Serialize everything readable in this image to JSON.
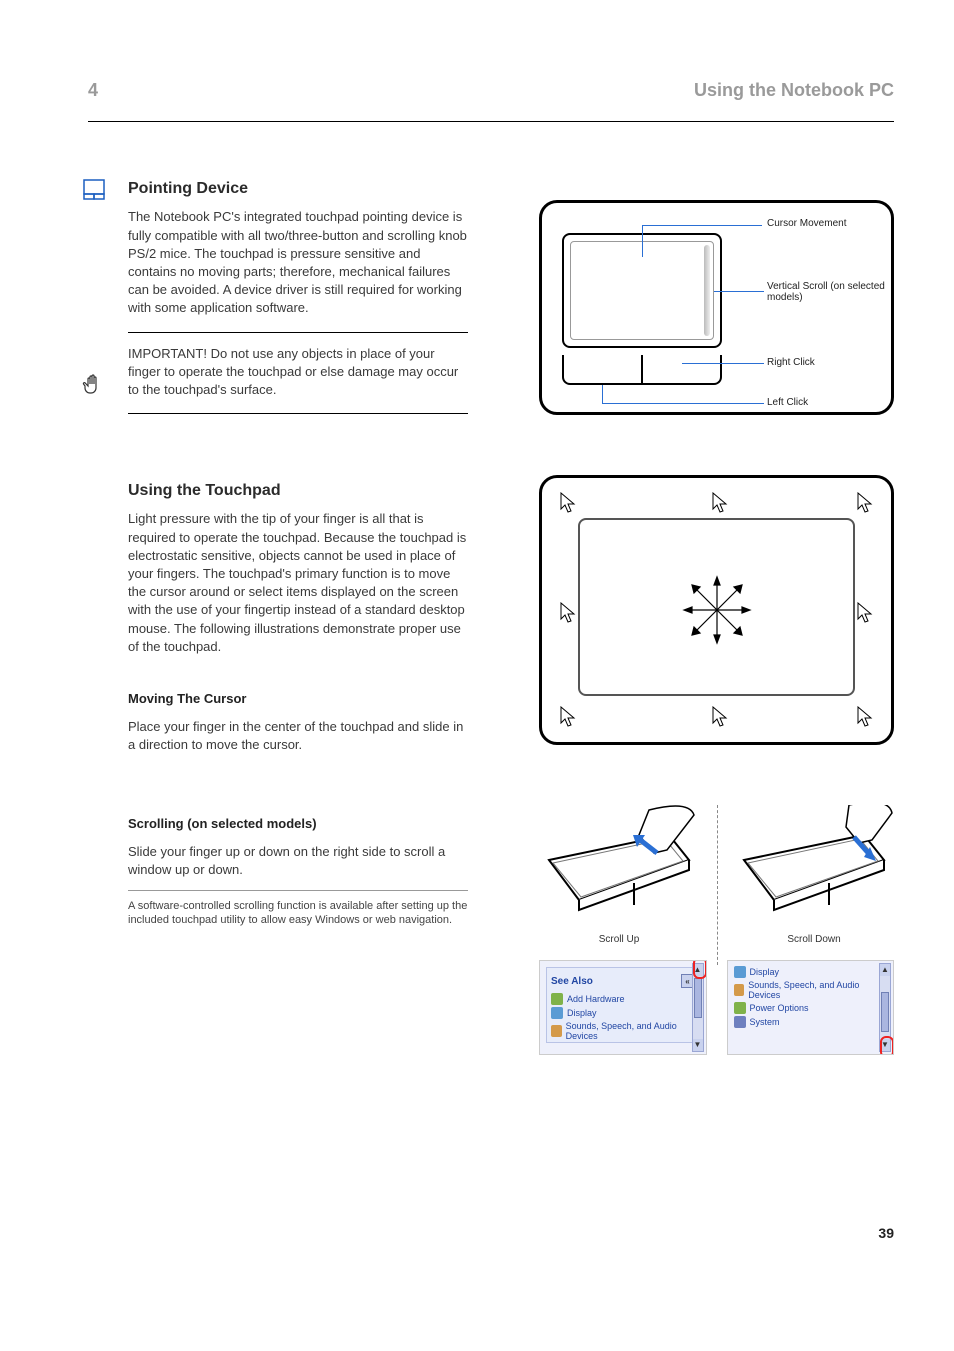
{
  "header": {
    "section_number": "4",
    "section_title": "Using the Notebook PC"
  },
  "sections": {
    "pointing_title": "Pointing Device",
    "pointing_text": "The Notebook PC's integrated touchpad pointing device is fully compatible with all two/three-button and scrolling knob PS/2 mice. The touchpad is pressure sensitive and contains no moving parts; therefore, mechanical failures can be avoided. A device driver is still required for working with some application software.",
    "important_text": "IMPORTANT! Do not use any objects in place of your finger to operate the touchpad or else damage may occur to the touchpad's surface.",
    "using_title": "Using the Touchpad",
    "using_text": "Light pressure with the tip of your finger is all that is required to operate the touchpad. Because the touchpad is electrostatic sensitive, objects cannot be used in place of your fingers. The touchpad's primary function is to move the cursor around or select items displayed on the screen with the use of your fingertip instead of a standard desktop mouse. The following illustrations demonstrate proper use of the touchpad.",
    "moving_title": "Moving The Cursor",
    "moving_text": "Place your finger in the center of the touchpad and slide in a direction to move the cursor.",
    "scrolling_title": "Scrolling (on selected models)",
    "scrolling_text": "Slide your finger up or down on the right side to scroll a window up or down.",
    "scrolling_note": "A software-controlled scrolling function is available after setting up the included touchpad utility to allow easy Windows or web navigation."
  },
  "callouts": {
    "movement": "Cursor Movement",
    "scroll": "Vertical Scroll (on selected models)",
    "right": "Right Click",
    "left": "Left Click"
  },
  "fig3": {
    "up": "Scroll Up",
    "down": "Scroll Down"
  },
  "shots": {
    "see_also": "See Also",
    "items_left": [
      "Add Hardware",
      "Display",
      "Sounds, Speech, and Audio Devices"
    ],
    "items_right": [
      "Display",
      "Sounds, Speech, and Audio Devices",
      "Power Options",
      "System"
    ]
  },
  "page_number": "39"
}
